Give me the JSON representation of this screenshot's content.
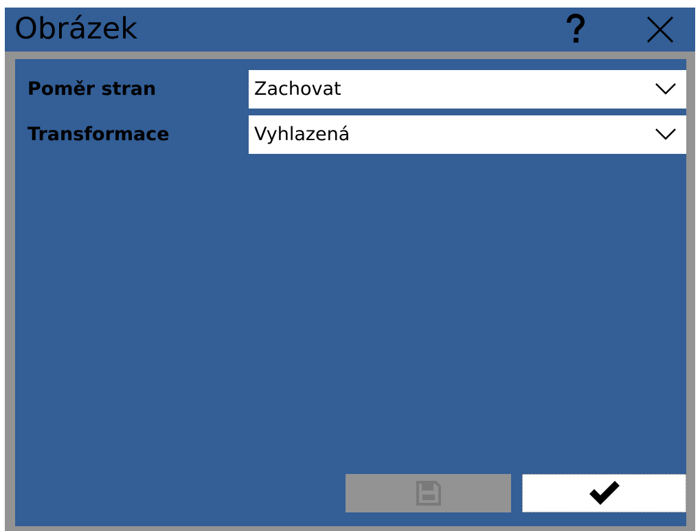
{
  "dialog": {
    "title": "Obrázek",
    "help_icon": "question-mark-icon",
    "close_icon": "close-x-icon"
  },
  "form": {
    "aspect_ratio": {
      "label": "Poměr stran",
      "value": "Zachovat"
    },
    "transformation": {
      "label": "Transformace",
      "value": "Vyhlazená"
    }
  },
  "buttons": {
    "save": {
      "icon": "floppy-disk-icon",
      "enabled": false
    },
    "ok": {
      "icon": "checkmark-icon",
      "enabled": true
    }
  },
  "colors": {
    "titlebar": "#335e96",
    "content_bg": "#335e96",
    "frame": "#939393",
    "disabled_button": "#939393",
    "field_bg": "#ffffff",
    "text": "#000000"
  }
}
